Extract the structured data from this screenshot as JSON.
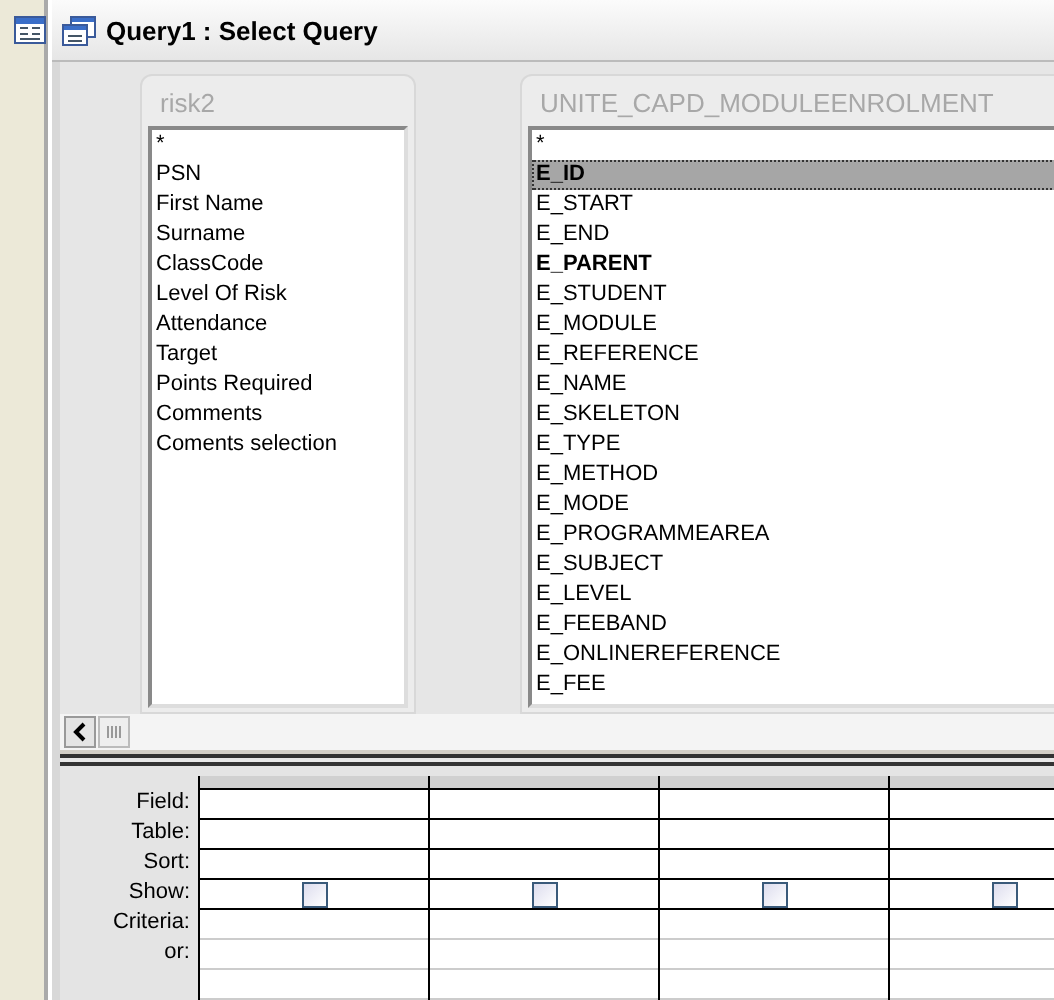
{
  "window": {
    "title": "Query1 : Select Query"
  },
  "tables": [
    {
      "name": "risk2",
      "fields": [
        {
          "label": "*",
          "primary_key": false,
          "selected": false
        },
        {
          "label": "PSN",
          "primary_key": false,
          "selected": false
        },
        {
          "label": "First Name",
          "primary_key": false,
          "selected": false
        },
        {
          "label": "Surname",
          "primary_key": false,
          "selected": false
        },
        {
          "label": "ClassCode",
          "primary_key": false,
          "selected": false
        },
        {
          "label": "Level Of Risk",
          "primary_key": false,
          "selected": false
        },
        {
          "label": "Attendance",
          "primary_key": false,
          "selected": false
        },
        {
          "label": "Target",
          "primary_key": false,
          "selected": false
        },
        {
          "label": "Points Required",
          "primary_key": false,
          "selected": false
        },
        {
          "label": "Comments",
          "primary_key": false,
          "selected": false
        },
        {
          "label": "Coments selection",
          "primary_key": false,
          "selected": false
        }
      ]
    },
    {
      "name": "UNITE_CAPD_MODULEENROLMENT",
      "fields": [
        {
          "label": "*",
          "primary_key": false,
          "selected": false
        },
        {
          "label": "E_ID",
          "primary_key": true,
          "selected": true
        },
        {
          "label": "E_START",
          "primary_key": false,
          "selected": false
        },
        {
          "label": "E_END",
          "primary_key": false,
          "selected": false
        },
        {
          "label": "E_PARENT",
          "primary_key": true,
          "selected": false
        },
        {
          "label": "E_STUDENT",
          "primary_key": false,
          "selected": false
        },
        {
          "label": "E_MODULE",
          "primary_key": false,
          "selected": false
        },
        {
          "label": "E_REFERENCE",
          "primary_key": false,
          "selected": false
        },
        {
          "label": "E_NAME",
          "primary_key": false,
          "selected": false
        },
        {
          "label": "E_SKELETON",
          "primary_key": false,
          "selected": false
        },
        {
          "label": "E_TYPE",
          "primary_key": false,
          "selected": false
        },
        {
          "label": "E_METHOD",
          "primary_key": false,
          "selected": false
        },
        {
          "label": "E_MODE",
          "primary_key": false,
          "selected": false
        },
        {
          "label": "E_PROGRAMMEAREA",
          "primary_key": false,
          "selected": false
        },
        {
          "label": "E_SUBJECT",
          "primary_key": false,
          "selected": false
        },
        {
          "label": "E_LEVEL",
          "primary_key": false,
          "selected": false
        },
        {
          "label": "E_FEEBAND",
          "primary_key": false,
          "selected": false
        },
        {
          "label": "E_ONLINEREFERENCE",
          "primary_key": false,
          "selected": false
        },
        {
          "label": "E_FEE",
          "primary_key": false,
          "selected": false
        }
      ]
    }
  ],
  "grid": {
    "row_labels": [
      "Field:",
      "Table:",
      "Sort:",
      "Show:",
      "Criteria:",
      "or:"
    ],
    "columns": [
      {
        "show": false
      },
      {
        "show": false
      },
      {
        "show": false
      },
      {
        "show": false
      }
    ]
  }
}
